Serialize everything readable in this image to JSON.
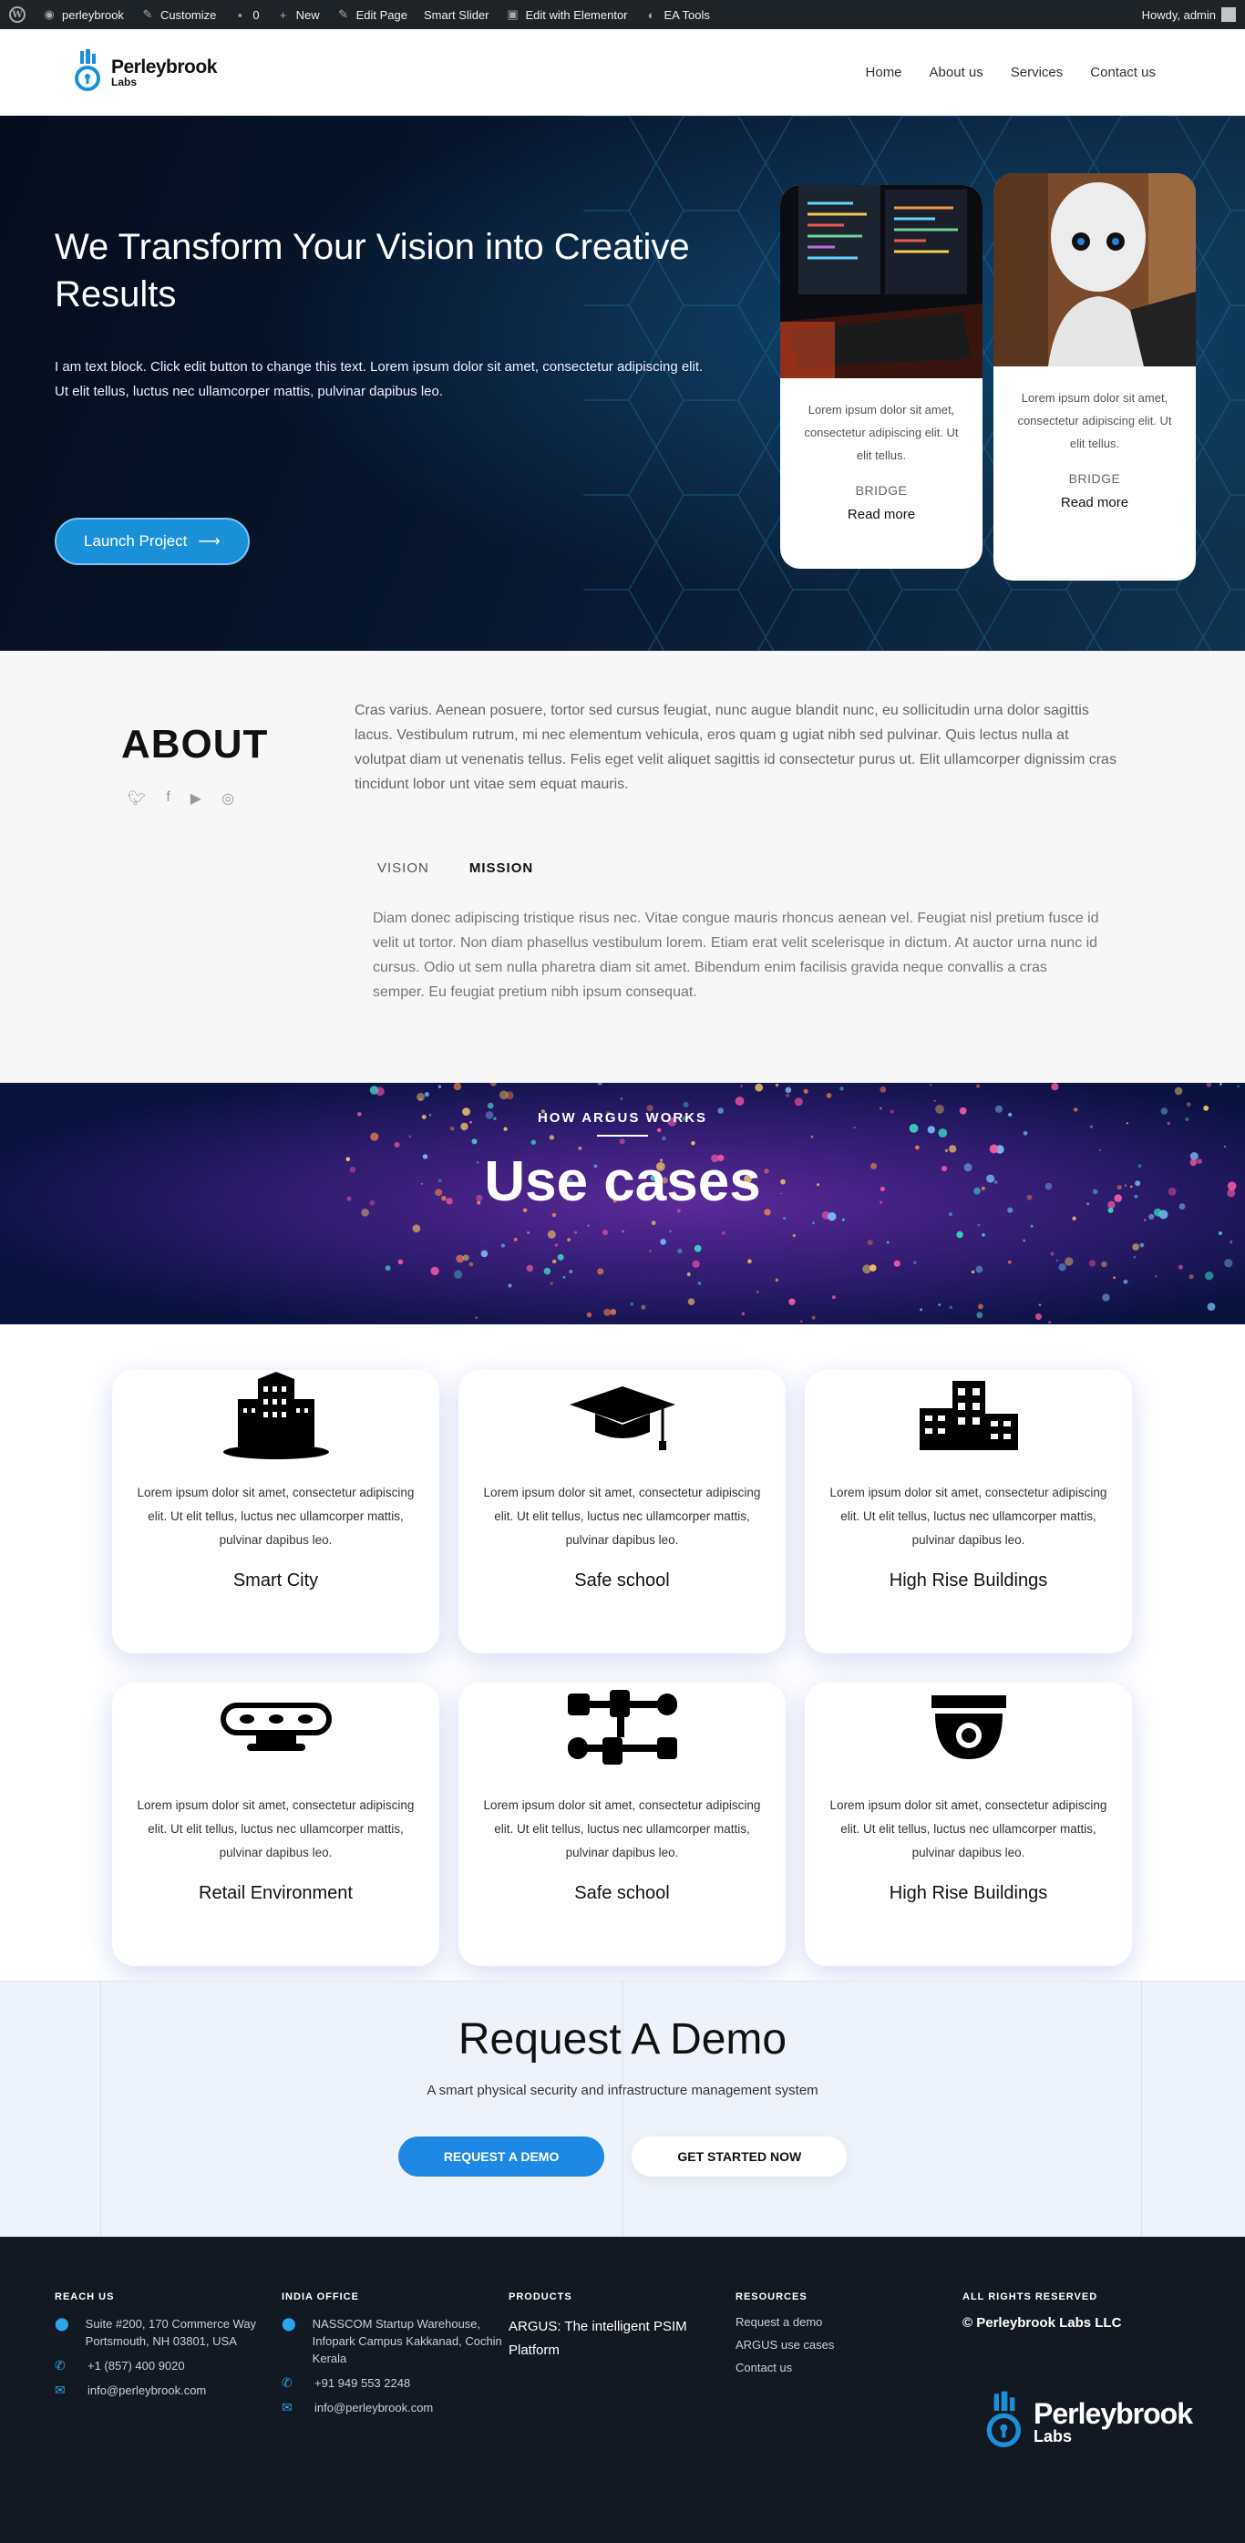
{
  "adminbar": {
    "site_name": "perleybrook",
    "customize": "Customize",
    "comments_count": "0",
    "new": "New",
    "edit_page": "Edit Page",
    "smart_slider": "Smart Slider",
    "edit_elementor": "Edit with Elementor",
    "ea_tools": "EA Tools",
    "howdy": "Howdy, admin"
  },
  "header": {
    "logo_line1": "Perleybrook",
    "logo_line2": "Labs",
    "nav": [
      "Home",
      "About us",
      "Services",
      "Contact us"
    ]
  },
  "hero": {
    "title": "We Transform Your Vision into Creative Results",
    "text": "I am text block. Click edit button to change this text. Lorem ipsum dolor sit amet, consectetur adipiscing elit. Ut elit tellus, luctus nec ullamcorper mattis, pulvinar dapibus leo.",
    "button": "Launch Project",
    "cards": [
      {
        "text": "Lorem ipsum dolor sit amet, consectetur adipiscing elit. Ut elit tellus.",
        "tag": "BRIDGE",
        "link": "Read more"
      },
      {
        "text": "Lorem ipsum dolor sit amet, consectetur adipiscing elit. Ut elit tellus.",
        "tag": "BRIDGE",
        "link": "Read more"
      }
    ]
  },
  "about": {
    "title": "ABOUT",
    "lead": "Cras varius. Aenean posuere, tortor sed cursus feugiat, nunc augue blandit nunc, eu sollicitudin urna dolor sagittis lacus. Vestibulum rutrum, mi nec elementum vehicula, eros quam g ugiat nibh sed pulvinar. Quis lectus nulla at volutpat diam ut venenatis tellus. Felis eget velit aliquet sagittis id consectetur purus ut. Elit ullamcorper dignissim cras tincidunt lobor unt vitae sem equat mauris.",
    "tabs": [
      "VISION",
      "MISSION"
    ],
    "tab_body": "Diam donec adipiscing tristique risus nec. Vitae congue mauris rhoncus aenean vel. Feugiat nisl pretium fusce id velit ut tortor. Non diam phasellus vestibulum lorem. Etiam erat velit scelerisque in dictum. At auctor urna nunc id cursus. Odio ut sem nulla pharetra diam sit amet. Bibendum enim facilisis gravida neque convallis a cras semper. Eu feugiat pretium nibh ipsum consequat."
  },
  "usecases": {
    "kicker": "HOW ARGUS WORKS",
    "title": "Use cases",
    "cards": [
      {
        "icon": "city-icon",
        "text": "Lorem ipsum dolor sit amet, consectetur adipiscing elit. Ut elit tellus, luctus nec ullamcorper mattis, pulvinar dapibus leo.",
        "title": "Smart City"
      },
      {
        "icon": "graduation-cap-icon",
        "text": "Lorem ipsum dolor sit amet, consectetur adipiscing elit. Ut elit tellus, luctus nec ullamcorper mattis, pulvinar dapibus leo.",
        "title": "Safe school"
      },
      {
        "icon": "buildings-icon",
        "text": "Lorem ipsum dolor sit amet, consectetur adipiscing elit. Ut elit tellus, luctus nec ullamcorper mattis, pulvinar dapibus leo.",
        "title": "High Rise Buildings"
      },
      {
        "icon": "sensor-icon",
        "text": "Lorem ipsum dolor sit amet, consectetur adipiscing elit. Ut elit tellus, luctus nec ullamcorper mattis, pulvinar dapibus leo.",
        "title": "Retail Environment"
      },
      {
        "icon": "network-icon",
        "text": "Lorem ipsum dolor sit amet, consectetur adipiscing elit. Ut elit tellus, luctus nec ullamcorper mattis, pulvinar dapibus leo.",
        "title": "Safe school"
      },
      {
        "icon": "dome-camera-icon",
        "text": "Lorem ipsum dolor sit amet, consectetur adipiscing elit. Ut elit tellus, luctus nec ullamcorper mattis, pulvinar dapibus leo.",
        "title": "High Rise Buildings"
      }
    ]
  },
  "demo": {
    "title": "Request A Demo",
    "subtitle": "A smart physical security and infrastructure management system",
    "btn_primary": "REQUEST A DEMO",
    "btn_secondary": "GET STARTED NOW"
  },
  "footer": {
    "reach_title": "REACH US",
    "reach_address": "Suite #200, 170 Commerce Way Portsmouth, NH 03801, USA",
    "reach_phone": "+1 (857) 400 9020",
    "reach_email": "info@perleybrook.com",
    "india_title": "INDIA OFFICE",
    "india_address": "NASSCOM Startup Warehouse, Infopark Campus Kakkanad, Cochin Kerala",
    "india_phone": "+91 949 553 2248",
    "india_email": "info@perleybrook.com",
    "products_title": "PRODUCTS",
    "product": "ARGUS: The intelligent PSIM Platform",
    "resources_title": "RESOURCES",
    "resources": [
      "Request a demo",
      "ARGUS use cases",
      "Contact us"
    ],
    "rights_title": "ALL RIGHTS RESERVED",
    "copyright": "© Perleybrook Labs LLC",
    "logo_line1": "Perleybrook",
    "logo_line2": "Labs"
  },
  "colors": {
    "accent": "#1e88e5",
    "hero_bg": "#0a1a33",
    "footer_bg": "#131922"
  }
}
